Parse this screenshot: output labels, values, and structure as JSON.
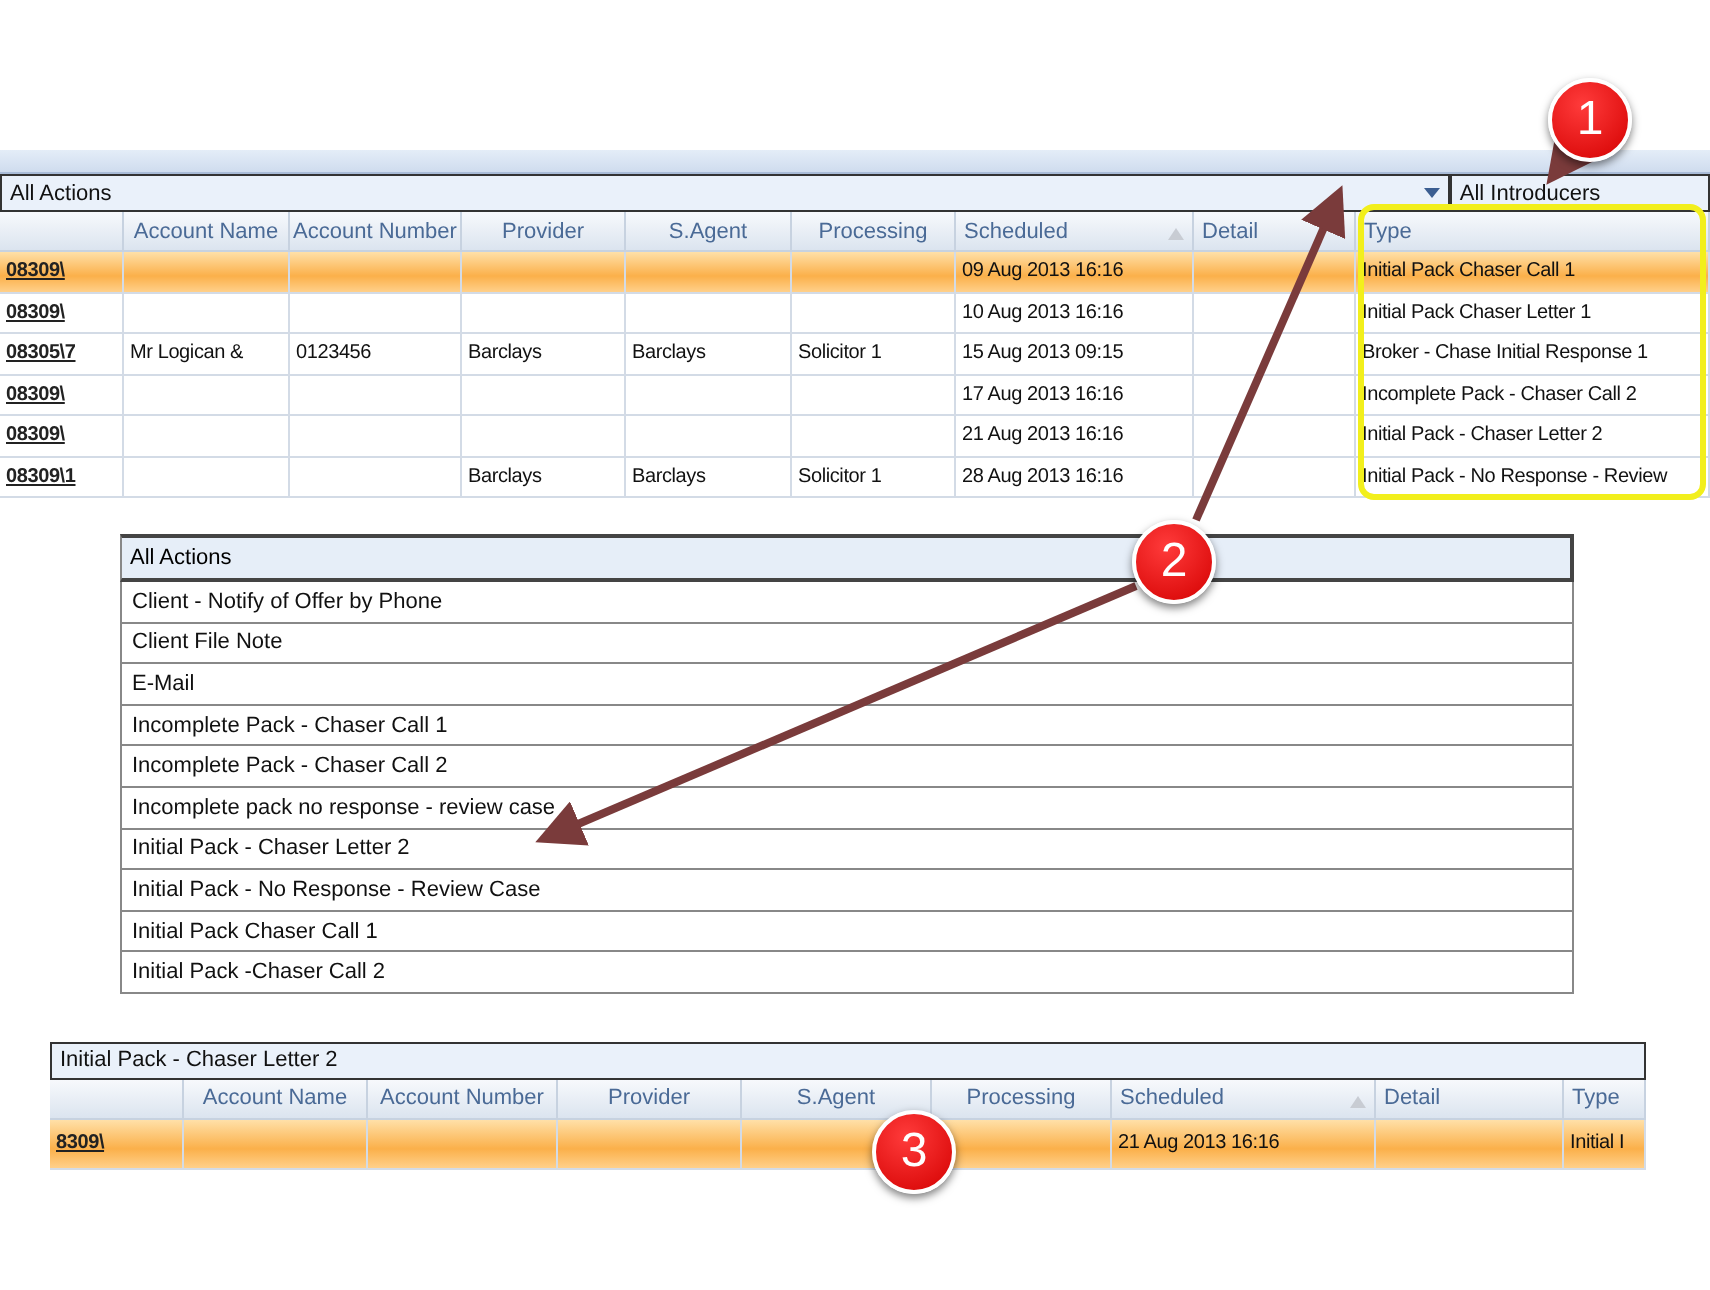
{
  "top_panel": {
    "action_filter": "All Actions",
    "introducer_filter": "All Introducers",
    "columns": [
      {
        "sorted": false
      },
      {
        "label": "Account Name",
        "sorted": false
      },
      {
        "label": "Account Number",
        "sorted": false
      },
      {
        "label": "Provider",
        "sorted": false
      },
      {
        "label": "S.Agent",
        "sorted": false
      },
      {
        "label": "Processing",
        "sorted": false
      },
      {
        "label": "Scheduled",
        "sorted": true
      },
      {
        "label": "Detail",
        "sorted": false
      },
      {
        "label": "Type",
        "sorted": false
      }
    ],
    "rows": [
      {
        "selected": true,
        "cells": [
          "08309\\",
          null,
          null,
          null,
          null,
          null,
          "09 Aug 2013 16:16",
          null,
          "Initial Pack Chaser Call 1"
        ]
      },
      {
        "selected": false,
        "cells": [
          "08309\\",
          null,
          null,
          null,
          null,
          null,
          "10 Aug 2013 16:16",
          null,
          "Initial Pack Chaser Letter 1"
        ]
      },
      {
        "selected": false,
        "cells": [
          "08305\\7",
          "Mr Logican &",
          "0123456",
          "Barclays",
          "Barclays",
          "Solicitor 1",
          "15 Aug 2013 09:15",
          null,
          "Broker - Chase Initial Response 1"
        ]
      },
      {
        "selected": false,
        "cells": [
          "08309\\",
          null,
          null,
          null,
          null,
          null,
          "17 Aug 2013 16:16",
          null,
          "Incomplete Pack - Chaser Call 2"
        ]
      },
      {
        "selected": false,
        "cells": [
          "08309\\",
          null,
          null,
          null,
          null,
          null,
          "21 Aug 2013 16:16",
          null,
          "Initial Pack - Chaser Letter  2"
        ]
      },
      {
        "selected": false,
        "cells": [
          "08309\\1",
          null,
          null,
          "Barclays",
          "Barclays",
          "Solicitor 1",
          "28 Aug 2013 16:16",
          null,
          "Initial Pack - No Response - Review"
        ]
      }
    ]
  },
  "dropdown": {
    "header": "All Actions",
    "items": [
      {
        "label": "Client - Notify of Offer by Phone",
        "selected": false
      },
      {
        "label": "Client File Note",
        "selected": false
      },
      {
        "label": "E-Mail",
        "selected": false
      },
      {
        "label": "Incomplete Pack - Chaser Call 1",
        "selected": false
      },
      {
        "label": "Incomplete Pack - Chaser Call 2",
        "selected": false
      },
      {
        "label": "Incomplete pack no response - review case",
        "selected": false
      },
      {
        "label": "Initial Pack - Chaser Letter  2",
        "selected": false
      },
      {
        "label": "Initial Pack - No Response - Review Case",
        "selected": false
      },
      {
        "label": "Initial Pack Chaser Call 1",
        "selected": false
      },
      {
        "label": "Initial Pack -Chaser Call 2",
        "selected": false
      }
    ]
  },
  "bottom_panel": {
    "action_filter": "Initial Pack - Chaser Letter  2",
    "columns": [
      {
        "sorted": false
      },
      {
        "label": "Account Name",
        "sorted": false
      },
      {
        "label": "Account Number",
        "sorted": false
      },
      {
        "label": "Provider",
        "sorted": false
      },
      {
        "label": "S.Agent",
        "sorted": false
      },
      {
        "label": "Processing",
        "sorted": false
      },
      {
        "label": "Scheduled",
        "sorted": true
      },
      {
        "label": "Detail",
        "sorted": false
      },
      {
        "label": "Type",
        "sorted": false
      }
    ],
    "rows": [
      {
        "selected": true,
        "cells": [
          "8309\\",
          null,
          null,
          null,
          null,
          null,
          "21 Aug 2013 16:16",
          null,
          "Initial I"
        ]
      }
    ]
  },
  "callouts": [
    {
      "number": "1"
    },
    {
      "number": "2"
    },
    {
      "number": "3"
    }
  ]
}
